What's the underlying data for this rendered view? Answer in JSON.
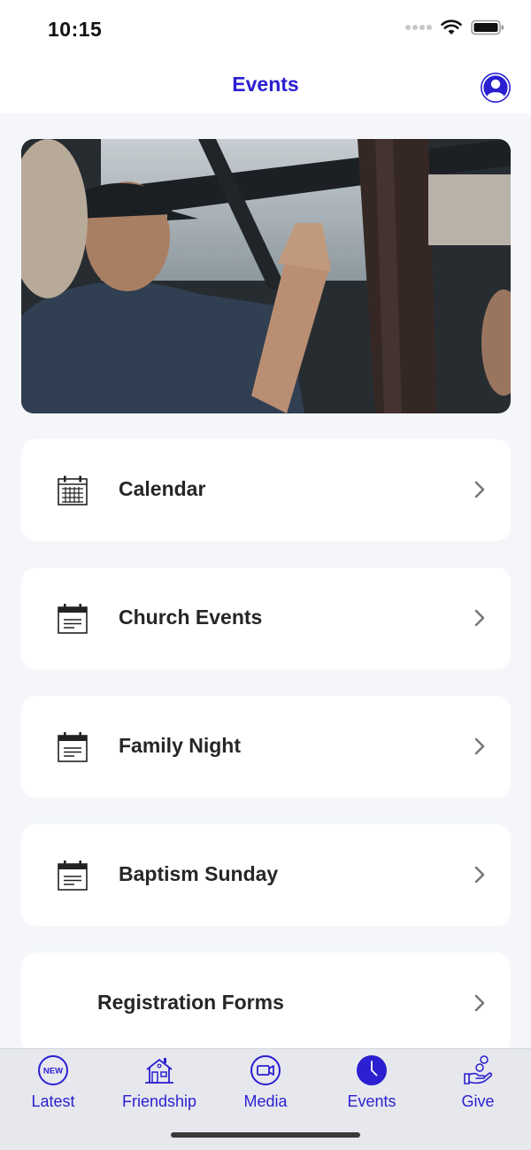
{
  "status_bar": {
    "time": "10:15"
  },
  "header": {
    "title": "Events",
    "profile_icon": "person-circle-icon"
  },
  "colors": {
    "accent": "#2a1fd1",
    "card_bg": "#ffffff",
    "page_bg": "#f4f6fa"
  },
  "hero": {
    "image": "friends-high-five-photo"
  },
  "menu": [
    {
      "label": "Calendar",
      "icon": "calendar-grid-icon"
    },
    {
      "label": "Church Events",
      "icon": "calendar-note-icon"
    },
    {
      "label": "Family Night",
      "icon": "calendar-note-icon"
    },
    {
      "label": "Baptism Sunday",
      "icon": "calendar-note-icon"
    },
    {
      "label": "Registration Forms",
      "icon": ""
    }
  ],
  "tabs": [
    {
      "label": "Latest",
      "icon": "new-badge-icon",
      "badge": "NEW"
    },
    {
      "label": "Friendship",
      "icon": "house-icon"
    },
    {
      "label": "Media",
      "icon": "video-camera-icon"
    },
    {
      "label": "Events",
      "icon": "clock-icon",
      "active": true
    },
    {
      "label": "Give",
      "icon": "hand-coins-icon"
    }
  ]
}
